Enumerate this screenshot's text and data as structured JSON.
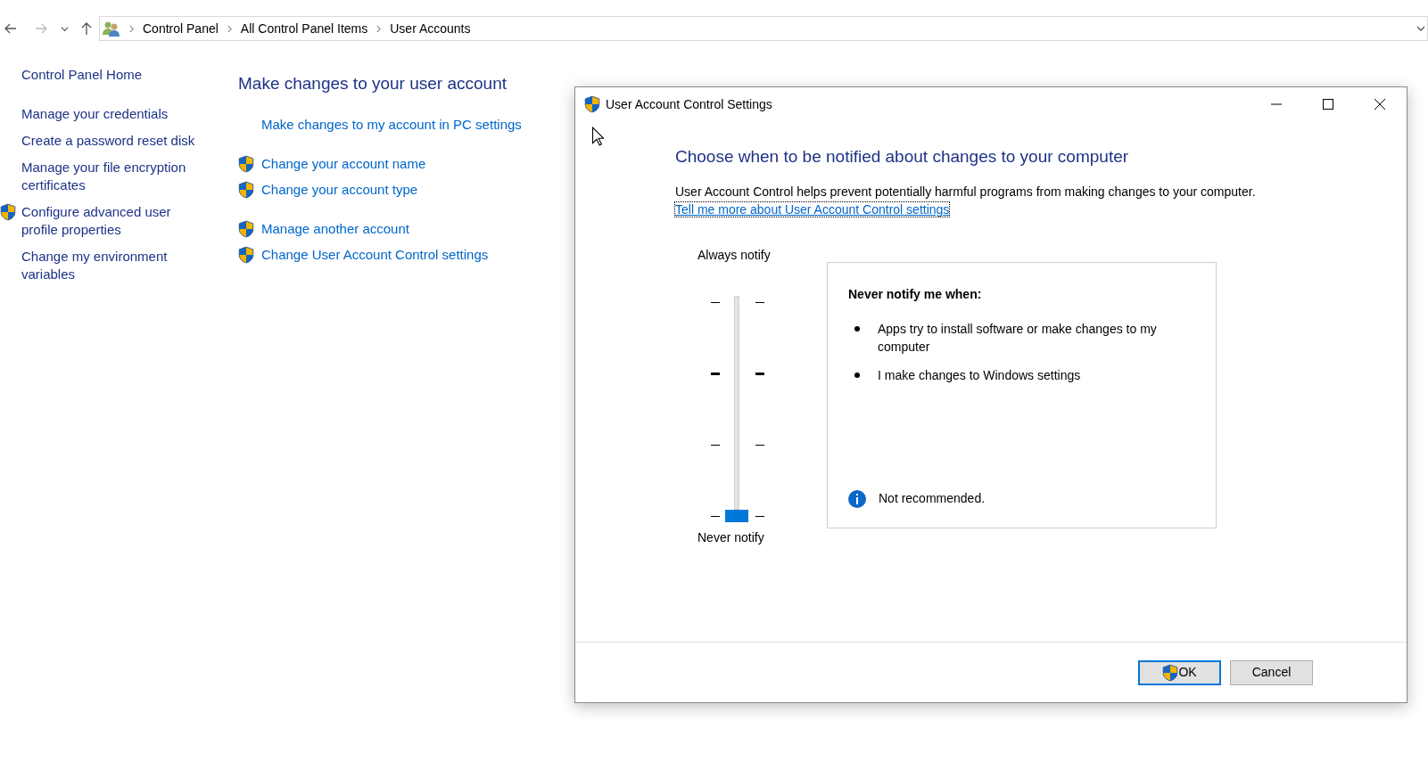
{
  "address_bar": {
    "crumbs": [
      "Control Panel",
      "All Control Panel Items",
      "User Accounts"
    ]
  },
  "sidebar": {
    "items": [
      {
        "label": "Control Panel Home",
        "shield": false
      },
      {
        "label": "Manage your credentials",
        "shield": false
      },
      {
        "label": "Create a password reset disk",
        "shield": false
      },
      {
        "label": "Manage your file encryption certificates",
        "shield": false
      },
      {
        "label": "Configure advanced user profile properties",
        "shield": true
      },
      {
        "label": "Change my environment variables",
        "shield": false
      }
    ]
  },
  "main": {
    "title": "Make changes to your user account",
    "link_groups": [
      [
        {
          "label": "Make changes to my account in PC settings",
          "shield": false
        }
      ],
      [
        {
          "label": "Change your account name",
          "shield": true
        },
        {
          "label": "Change your account type",
          "shield": true
        }
      ],
      [
        {
          "label": "Manage another account",
          "shield": true
        },
        {
          "label": "Change User Account Control settings",
          "shield": true
        }
      ]
    ]
  },
  "dialog": {
    "title": "User Account Control Settings",
    "heading": "Choose when to be notified about changes to your computer",
    "description": "User Account Control helps prevent potentially harmful programs from making changes to your computer.",
    "link": "Tell me more about User Account Control settings",
    "slider": {
      "top_label": "Always notify",
      "bottom_label": "Never notify",
      "level": 0
    },
    "info": {
      "title": "Never notify me when:",
      "bullets": [
        "Apps try to install software or make changes to my computer",
        "I make changes to Windows settings"
      ],
      "note": "Not recommended."
    },
    "buttons": [
      {
        "label": "OK",
        "shield": true,
        "selected": true
      },
      {
        "label": "Cancel",
        "shield": false,
        "selected": false
      }
    ]
  }
}
